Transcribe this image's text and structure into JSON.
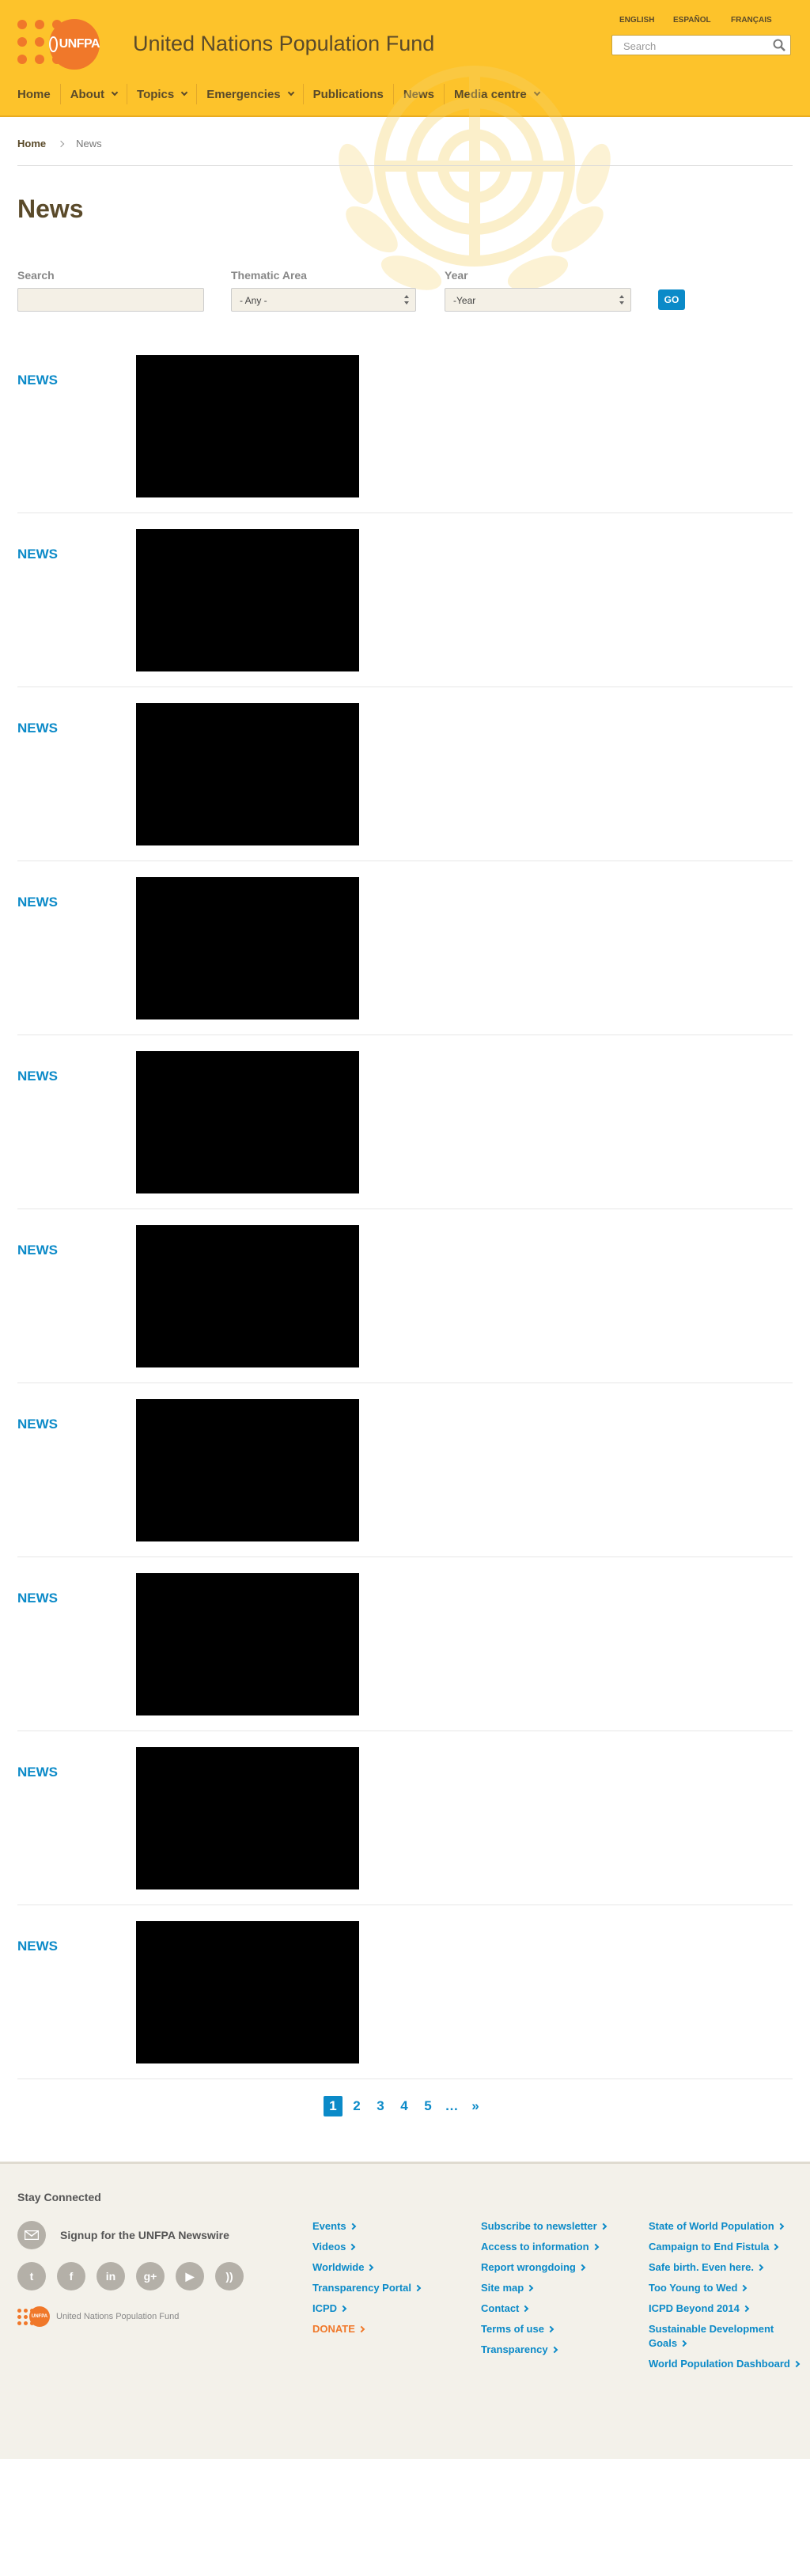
{
  "header": {
    "org_name": "United Nations Population Fund",
    "logo_text": "UNFPA",
    "languages": [
      "ENGLISH",
      "ESPAÑOL",
      "FRANÇAIS"
    ],
    "search_placeholder": "Search",
    "nav": [
      {
        "label": "Home",
        "dropdown": false
      },
      {
        "label": "About",
        "dropdown": true
      },
      {
        "label": "Topics",
        "dropdown": true
      },
      {
        "label": "Emergencies",
        "dropdown": true
      },
      {
        "label": "Publications",
        "dropdown": false
      },
      {
        "label": "News",
        "dropdown": false
      },
      {
        "label": "Media centre",
        "dropdown": true
      }
    ]
  },
  "breadcrumb": {
    "home": "Home",
    "current": "News"
  },
  "page_title": "News",
  "filters": {
    "search_label": "Search",
    "search_value": "",
    "thematic_label": "Thematic Area",
    "thematic_value": "- Any -",
    "year_label": "Year",
    "year_value": "-Year",
    "go_label": "GO"
  },
  "news_items": [
    {
      "tag": "NEWS"
    },
    {
      "tag": "NEWS"
    },
    {
      "tag": "NEWS"
    },
    {
      "tag": "NEWS"
    },
    {
      "tag": "NEWS"
    },
    {
      "tag": "NEWS"
    },
    {
      "tag": "NEWS"
    },
    {
      "tag": "NEWS"
    },
    {
      "tag": "NEWS"
    },
    {
      "tag": "NEWS"
    }
  ],
  "pagination": {
    "pages": [
      "1",
      "2",
      "3",
      "4",
      "5"
    ],
    "current": "1",
    "ellipsis": "…",
    "next": "»"
  },
  "footer": {
    "stay_connected": "Stay Connected",
    "newswire": "Signup for the UNFPA Newswire",
    "social": [
      "twitter-icon",
      "facebook-icon",
      "linkedin-icon",
      "googleplus-icon",
      "youtube-icon",
      "rss-icon"
    ],
    "logo_name": "United Nations Population Fund",
    "col1": [
      "Events",
      "Videos",
      "Worldwide",
      "Transparency Portal",
      "ICPD",
      "DONATE"
    ],
    "col2": [
      "Subscribe to newsletter",
      "Access to information",
      "Report wrongdoing",
      "Site map",
      "Contact",
      "Terms of use",
      "Transparency"
    ],
    "col3": [
      "State of World Population",
      "Campaign to End Fistula",
      "Safe birth. Even here.",
      "Too Young to Wed",
      "ICPD Beyond 2014",
      "Sustainable Development Goals",
      "World Population Dashboard"
    ]
  },
  "colors": {
    "header_bg": "#fdc32b",
    "brand_orange": "#f0782a",
    "link_blue": "#0b8ac8",
    "footer_bg": "#f3f1ea"
  }
}
